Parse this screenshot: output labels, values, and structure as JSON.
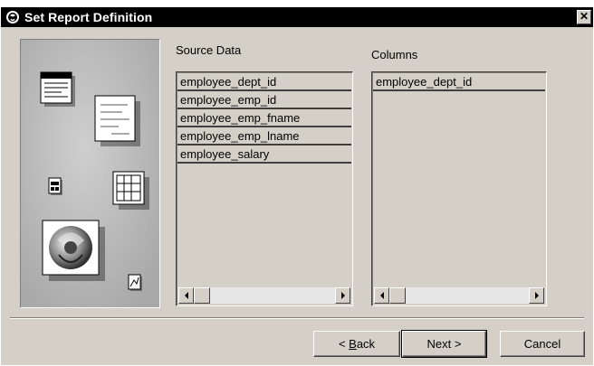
{
  "window": {
    "title": "Set Report Definition",
    "close_glyph": "✕"
  },
  "labels": {
    "source": "Source Data",
    "columns": "Columns"
  },
  "source_data": {
    "items": [
      "employee_dept_id",
      "employee_emp_id",
      "employee_emp_fname",
      "employee_emp_lname",
      "employee_salary"
    ]
  },
  "columns": {
    "items": [
      "employee_dept_id"
    ]
  },
  "buttons": {
    "back_prefix": "< ",
    "back_mnemonic": "B",
    "back_rest": "ack",
    "next": "Next >",
    "cancel": "Cancel"
  },
  "colors": {
    "face": "#d4d0c8",
    "title_bg": "#000000",
    "art_bg": "#b8b8b8"
  },
  "art_icons": [
    "report-icon",
    "document-icon",
    "small-form-icon",
    "grid-table-icon",
    "sphere-logo-icon",
    "chart-file-icon"
  ]
}
